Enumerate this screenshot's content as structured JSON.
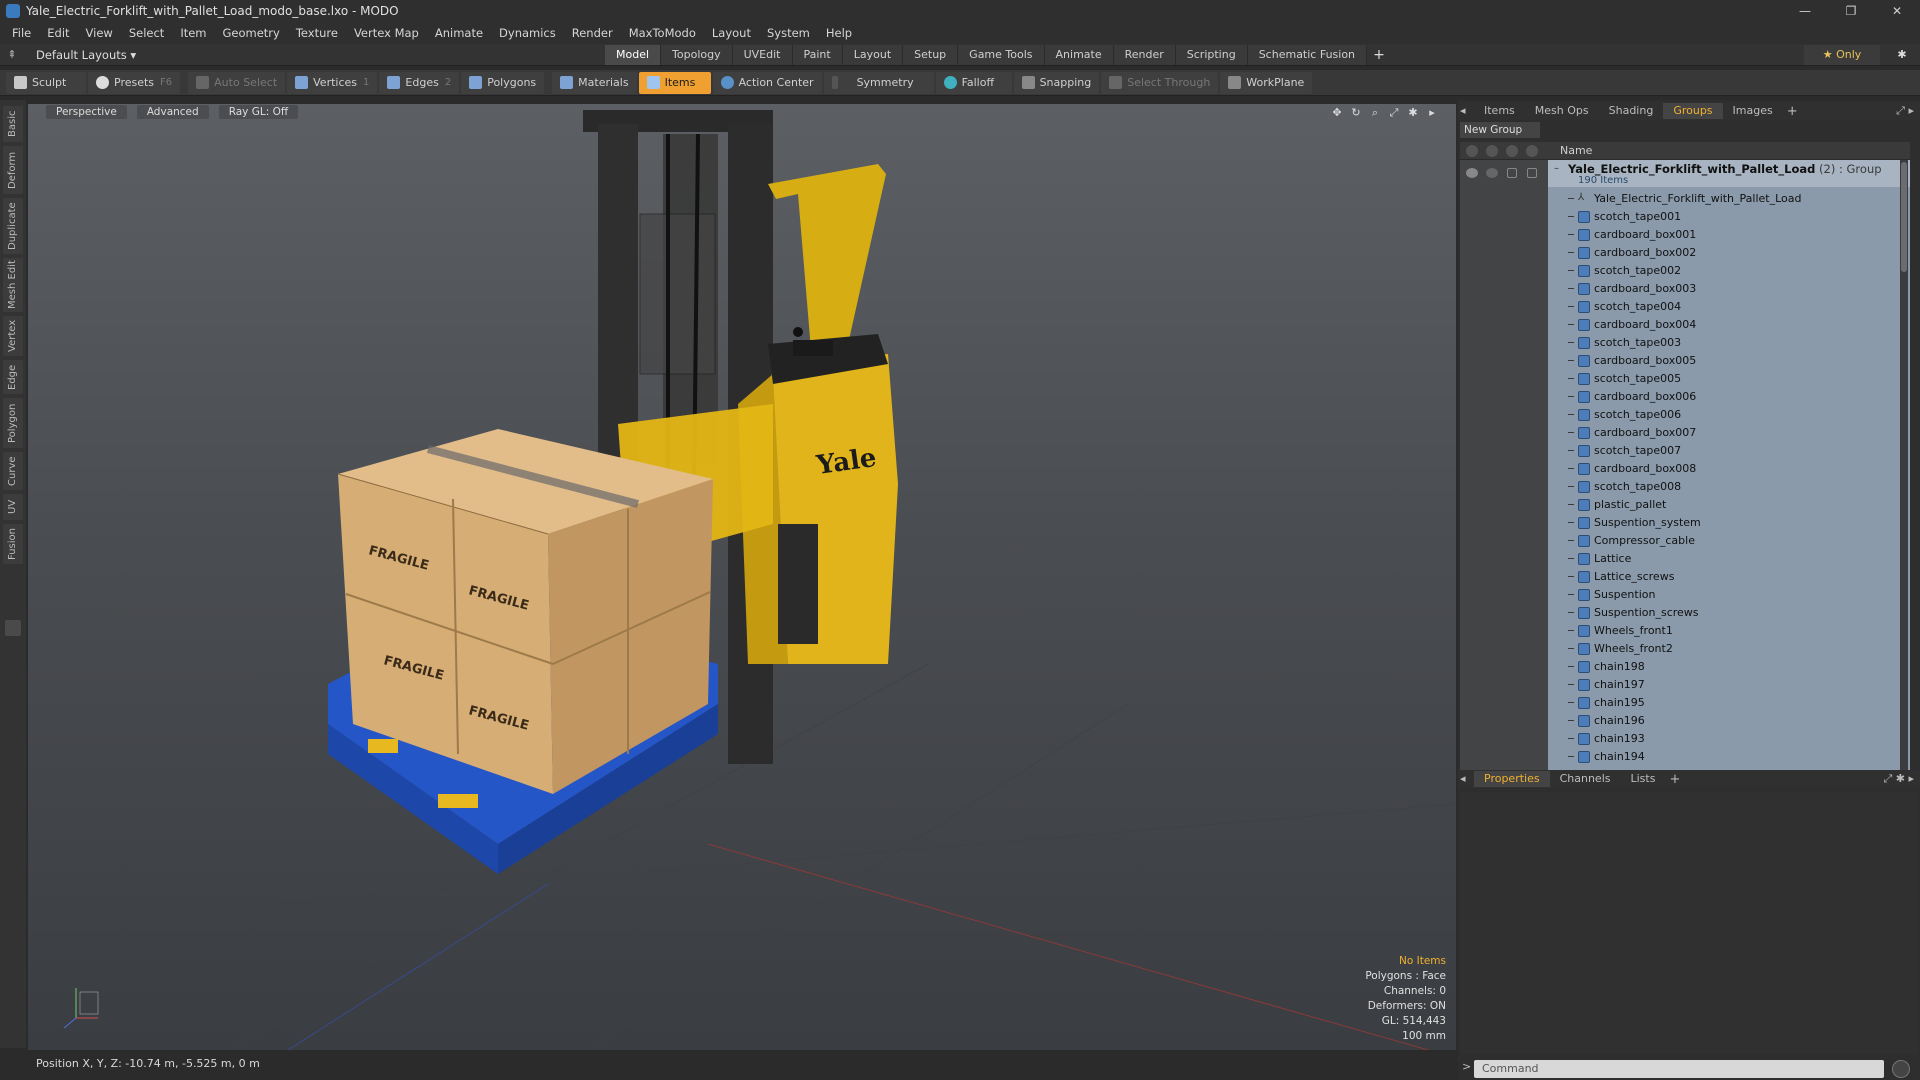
{
  "window": {
    "title": "Yale_Electric_Forklift_with_Pallet_Load_modo_base.lxo - MODO",
    "controls": [
      "—",
      "❐",
      "✕"
    ]
  },
  "menu": [
    "File",
    "Edit",
    "View",
    "Select",
    "Item",
    "Geometry",
    "Texture",
    "Vertex Map",
    "Animate",
    "Dynamics",
    "Render",
    "MaxToModo",
    "Layout",
    "System",
    "Help"
  ],
  "layoutbar": {
    "layouts_label": "Default Layouts ▾",
    "tabs": [
      "Model",
      "Topology",
      "UVEdit",
      "Paint",
      "Layout",
      "Setup",
      "Game Tools",
      "Animate",
      "Render",
      "Scripting",
      "Schematic Fusion"
    ],
    "active_tab": "Model",
    "add": "+",
    "only_label": "★  Only",
    "gear": "✱"
  },
  "toolbar": {
    "sculpt": "Sculpt",
    "presets": "Presets",
    "presets_key": "F6",
    "auto_select": "Auto Select",
    "vertices": "Vertices",
    "vertices_key": "1",
    "edges": "Edges",
    "edges_key": "2",
    "polygons": "Polygons",
    "materials": "Materials",
    "items": "Items",
    "action_center": "Action Center",
    "symmetry": "Symmetry",
    "falloff": "Falloff",
    "snapping": "Snapping",
    "select_through": "Select Through",
    "workplane": "WorkPlane"
  },
  "lefttabs": [
    "Basic",
    "Deform",
    "Duplicate",
    "Mesh Edit",
    "Vertex",
    "Edge",
    "Polygon",
    "Curve",
    "UV",
    "Fusion"
  ],
  "viewport": {
    "perspective": "Perspective",
    "advanced": "Advanced",
    "raygl": "Ray GL: Off",
    "info": {
      "no_items": "No Items",
      "polygons": "Polygons : Face",
      "channels": "Channels: 0",
      "deformers": "Deformers: ON",
      "gl": "GL: 514,443",
      "scale": "100 mm"
    },
    "box_label": "FRAGILE",
    "brand": "Yale"
  },
  "status": {
    "position": "Position X, Y, Z:  -10.74 m, -5.525 m, 0 m"
  },
  "rightpanel": {
    "tabs": [
      "Items",
      "Mesh Ops",
      "Shading",
      "Groups",
      "Images"
    ],
    "active_tab": "Groups",
    "add": "+",
    "new_group": "New Group",
    "name_header": "Name",
    "group": {
      "name": "Yale_Electric_Forklift_with_Pallet_Load",
      "type": " (2) : Group",
      "count": "190 Items"
    },
    "items": [
      "Yale_Electric_Forklift_with_Pallet_Load",
      "scotch_tape001",
      "cardboard_box001",
      "cardboard_box002",
      "scotch_tape002",
      "cardboard_box003",
      "scotch_tape004",
      "cardboard_box004",
      "scotch_tape003",
      "cardboard_box005",
      "scotch_tape005",
      "cardboard_box006",
      "scotch_tape006",
      "cardboard_box007",
      "scotch_tape007",
      "cardboard_box008",
      "scotch_tape008",
      "plastic_pallet",
      "Suspention_system",
      "Compressor_cable",
      "Lattice",
      "Lattice_screws",
      "Suspention",
      "Suspention_screws",
      "Wheels_front1",
      "Wheels_front2",
      "chain198",
      "chain197",
      "chain195",
      "chain196",
      "chain193",
      "chain194"
    ],
    "bottom_tabs": [
      "Properties",
      "Channels",
      "Lists"
    ],
    "bottom_active": "Properties",
    "command_placeholder": "Command"
  },
  "colors": {
    "accent": "#f0a030",
    "forklift_yellow": "#e8c020",
    "pallet_blue": "#2255cc",
    "box_cardboard": "#d9b07a"
  }
}
